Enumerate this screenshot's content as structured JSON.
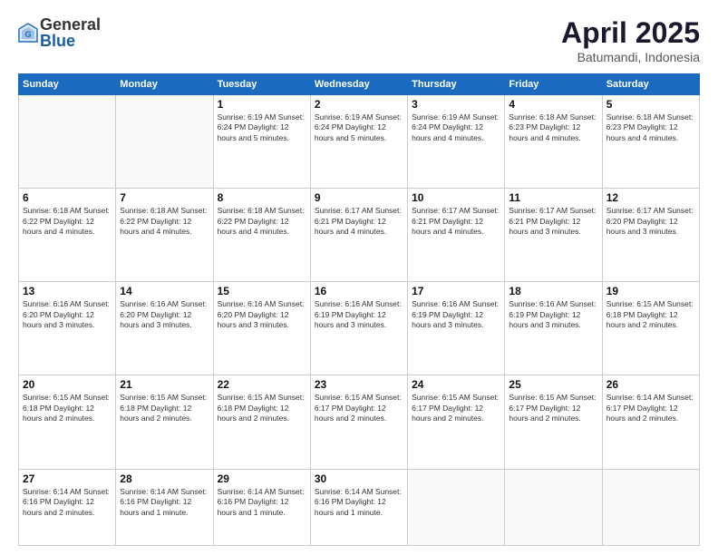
{
  "logo": {
    "general": "General",
    "blue": "Blue"
  },
  "title": {
    "month": "April 2025",
    "location": "Batumandi, Indonesia"
  },
  "weekdays": [
    "Sunday",
    "Monday",
    "Tuesday",
    "Wednesday",
    "Thursday",
    "Friday",
    "Saturday"
  ],
  "weeks": [
    [
      {
        "day": "",
        "info": ""
      },
      {
        "day": "",
        "info": ""
      },
      {
        "day": "1",
        "info": "Sunrise: 6:19 AM\nSunset: 6:24 PM\nDaylight: 12 hours\nand 5 minutes."
      },
      {
        "day": "2",
        "info": "Sunrise: 6:19 AM\nSunset: 6:24 PM\nDaylight: 12 hours\nand 5 minutes."
      },
      {
        "day": "3",
        "info": "Sunrise: 6:19 AM\nSunset: 6:24 PM\nDaylight: 12 hours\nand 4 minutes."
      },
      {
        "day": "4",
        "info": "Sunrise: 6:18 AM\nSunset: 6:23 PM\nDaylight: 12 hours\nand 4 minutes."
      },
      {
        "day": "5",
        "info": "Sunrise: 6:18 AM\nSunset: 6:23 PM\nDaylight: 12 hours\nand 4 minutes."
      }
    ],
    [
      {
        "day": "6",
        "info": "Sunrise: 6:18 AM\nSunset: 6:22 PM\nDaylight: 12 hours\nand 4 minutes."
      },
      {
        "day": "7",
        "info": "Sunrise: 6:18 AM\nSunset: 6:22 PM\nDaylight: 12 hours\nand 4 minutes."
      },
      {
        "day": "8",
        "info": "Sunrise: 6:18 AM\nSunset: 6:22 PM\nDaylight: 12 hours\nand 4 minutes."
      },
      {
        "day": "9",
        "info": "Sunrise: 6:17 AM\nSunset: 6:21 PM\nDaylight: 12 hours\nand 4 minutes."
      },
      {
        "day": "10",
        "info": "Sunrise: 6:17 AM\nSunset: 6:21 PM\nDaylight: 12 hours\nand 4 minutes."
      },
      {
        "day": "11",
        "info": "Sunrise: 6:17 AM\nSunset: 6:21 PM\nDaylight: 12 hours\nand 3 minutes."
      },
      {
        "day": "12",
        "info": "Sunrise: 6:17 AM\nSunset: 6:20 PM\nDaylight: 12 hours\nand 3 minutes."
      }
    ],
    [
      {
        "day": "13",
        "info": "Sunrise: 6:16 AM\nSunset: 6:20 PM\nDaylight: 12 hours\nand 3 minutes."
      },
      {
        "day": "14",
        "info": "Sunrise: 6:16 AM\nSunset: 6:20 PM\nDaylight: 12 hours\nand 3 minutes."
      },
      {
        "day": "15",
        "info": "Sunrise: 6:16 AM\nSunset: 6:20 PM\nDaylight: 12 hours\nand 3 minutes."
      },
      {
        "day": "16",
        "info": "Sunrise: 6:16 AM\nSunset: 6:19 PM\nDaylight: 12 hours\nand 3 minutes."
      },
      {
        "day": "17",
        "info": "Sunrise: 6:16 AM\nSunset: 6:19 PM\nDaylight: 12 hours\nand 3 minutes."
      },
      {
        "day": "18",
        "info": "Sunrise: 6:16 AM\nSunset: 6:19 PM\nDaylight: 12 hours\nand 3 minutes."
      },
      {
        "day": "19",
        "info": "Sunrise: 6:15 AM\nSunset: 6:18 PM\nDaylight: 12 hours\nand 2 minutes."
      }
    ],
    [
      {
        "day": "20",
        "info": "Sunrise: 6:15 AM\nSunset: 6:18 PM\nDaylight: 12 hours\nand 2 minutes."
      },
      {
        "day": "21",
        "info": "Sunrise: 6:15 AM\nSunset: 6:18 PM\nDaylight: 12 hours\nand 2 minutes."
      },
      {
        "day": "22",
        "info": "Sunrise: 6:15 AM\nSunset: 6:18 PM\nDaylight: 12 hours\nand 2 minutes."
      },
      {
        "day": "23",
        "info": "Sunrise: 6:15 AM\nSunset: 6:17 PM\nDaylight: 12 hours\nand 2 minutes."
      },
      {
        "day": "24",
        "info": "Sunrise: 6:15 AM\nSunset: 6:17 PM\nDaylight: 12 hours\nand 2 minutes."
      },
      {
        "day": "25",
        "info": "Sunrise: 6:15 AM\nSunset: 6:17 PM\nDaylight: 12 hours\nand 2 minutes."
      },
      {
        "day": "26",
        "info": "Sunrise: 6:14 AM\nSunset: 6:17 PM\nDaylight: 12 hours\nand 2 minutes."
      }
    ],
    [
      {
        "day": "27",
        "info": "Sunrise: 6:14 AM\nSunset: 6:16 PM\nDaylight: 12 hours\nand 2 minutes."
      },
      {
        "day": "28",
        "info": "Sunrise: 6:14 AM\nSunset: 6:16 PM\nDaylight: 12 hours\nand 1 minute."
      },
      {
        "day": "29",
        "info": "Sunrise: 6:14 AM\nSunset: 6:16 PM\nDaylight: 12 hours\nand 1 minute."
      },
      {
        "day": "30",
        "info": "Sunrise: 6:14 AM\nSunset: 6:16 PM\nDaylight: 12 hours\nand 1 minute."
      },
      {
        "day": "",
        "info": ""
      },
      {
        "day": "",
        "info": ""
      },
      {
        "day": "",
        "info": ""
      }
    ]
  ]
}
